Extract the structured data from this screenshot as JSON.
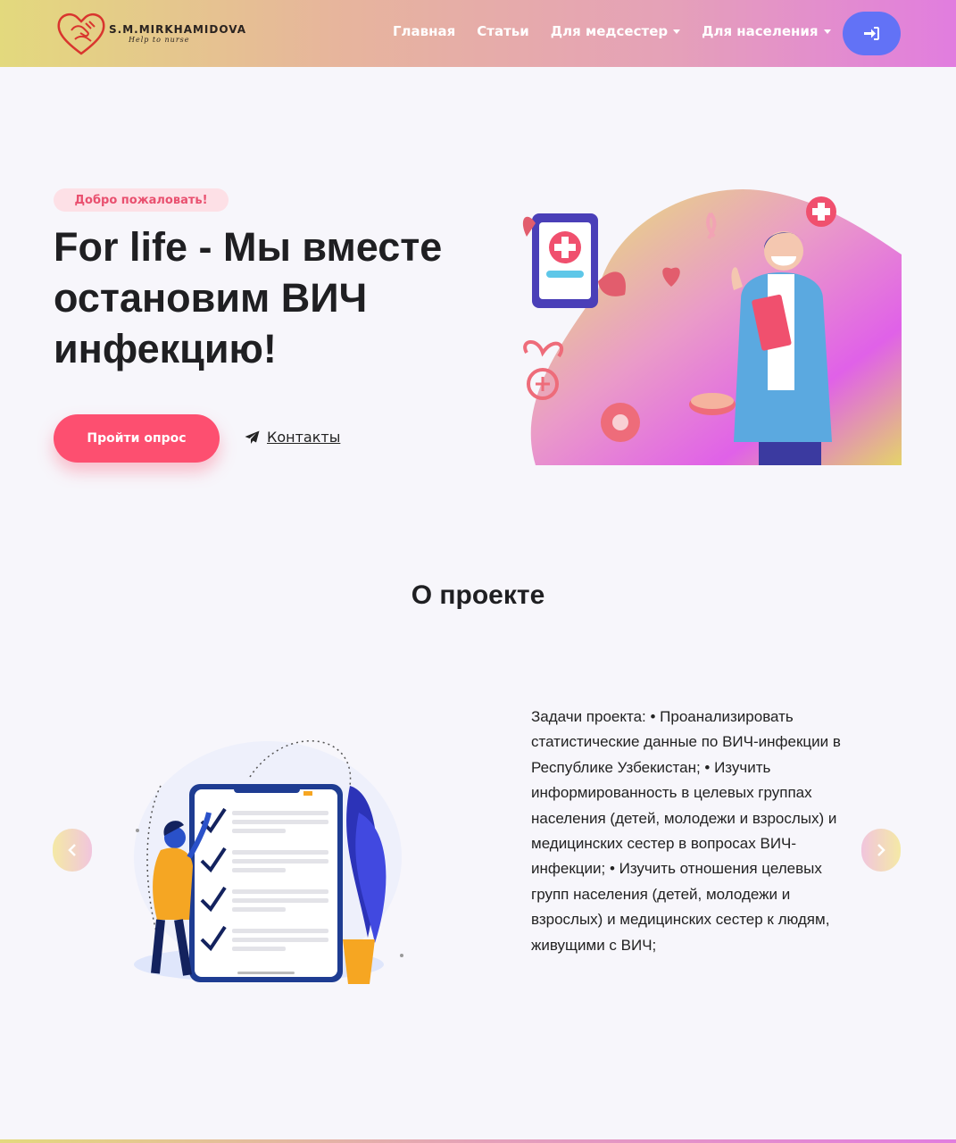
{
  "brand": {
    "name": "S.M.MIRKHAMIDOVA",
    "tagline": "Help to nurse"
  },
  "nav": {
    "items": [
      {
        "label": "Главная"
      },
      {
        "label": "Статьи"
      },
      {
        "label": "Для медсестер",
        "dropdown": true
      },
      {
        "label": "Для населения",
        "dropdown": true
      }
    ],
    "login_icon": "sign-in-icon"
  },
  "hero": {
    "badge": "Добро пожаловать!",
    "title": "For life - Мы вместе остановим ВИЧ инфекцию!",
    "primary_button": "Пройти опрос",
    "secondary_link": "Контакты",
    "secondary_icon": "paper-plane-icon"
  },
  "about": {
    "title": "О проекте",
    "text": "Задачи проекта: • Проанализировать статистические данные по ВИЧ-инфекции в Республике Узбекистан; • Изучить информированность в целевых группах населения (детей, молодежи и взрослых) и медицинских сестер в вопросах ВИЧ-инфекции; • Изучить отношения целевых групп населения (детей, молодежи и взрослых) и медицинских сестер к людям, живущими с ВИЧ;",
    "prev_icon": "chevron-left-icon",
    "next_icon": "chevron-right-icon"
  },
  "colors": {
    "accent": "#fd4f70",
    "login": "#6272f6",
    "nav_gradient_start": "#e3d97d",
    "nav_gradient_end": "#e17ddf"
  }
}
